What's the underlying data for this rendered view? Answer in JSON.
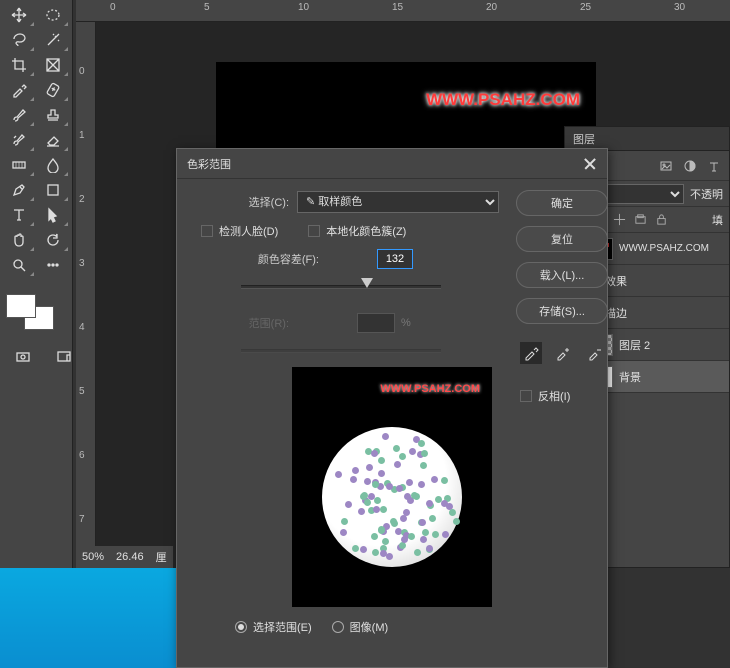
{
  "ruler_h": [
    "0",
    "5",
    "10",
    "15",
    "20",
    "25",
    "30"
  ],
  "ruler_v": [
    "0",
    "1",
    "2",
    "3",
    "4",
    "5",
    "6",
    "7"
  ],
  "status": {
    "zoom": "50%",
    "doc": "26.46",
    "unit": "厘"
  },
  "canvas": {
    "watermark": "WWW.PSAHZ.COM"
  },
  "dialog": {
    "title": "色彩范围",
    "select_label": "选择(C):",
    "select_value": "✎ 取样颜色",
    "detect_faces": "检测人脸(D)",
    "local_clusters": "本地化颜色簇(Z)",
    "fuzziness": "颜色容差(F):",
    "fuzziness_value": "132",
    "range": "范围(R):",
    "range_unit": "%",
    "preview_wm": "WWW.PSAHZ.COM",
    "radio_selection": "选择范围(E)",
    "radio_image": "图像(M)"
  },
  "buttons": {
    "ok": "确定",
    "reset": "复位",
    "load": "载入(L)...",
    "save": "存储(S)...",
    "invert": "反相(I)"
  },
  "panel": {
    "tab": "图层",
    "opacity": "不透明",
    "fill": "填",
    "layer_text": "WWW.PSAHZ.COM",
    "fx": "效果",
    "stroke": "描边",
    "layer2": "图层 2",
    "bg": "背景"
  }
}
